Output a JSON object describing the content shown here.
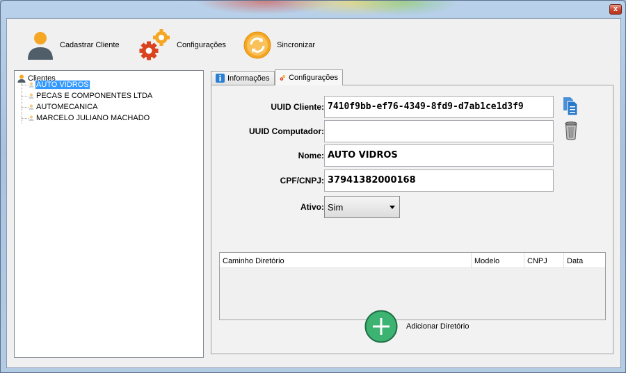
{
  "window": {
    "close_symbol": "x"
  },
  "toolbar": {
    "items": [
      {
        "label": "Cadastrar Cliente",
        "icon": "user-icon"
      },
      {
        "label": "Configurações",
        "icon": "gears-icon"
      },
      {
        "label": "Sincronizar",
        "icon": "sync-icon"
      }
    ]
  },
  "tree": {
    "root": "Clientes",
    "items": [
      {
        "label": "AUTO VIDROS",
        "selected": true
      },
      {
        "label": "PECAS E COMPONENTES LTDA",
        "selected": false
      },
      {
        "label": "AUTOMECANICA",
        "selected": false
      },
      {
        "label": "MARCELO JULIANO MACHADO",
        "selected": false
      }
    ]
  },
  "tabs": [
    {
      "label": "Informações",
      "active": false
    },
    {
      "label": "Configurações",
      "active": true
    }
  ],
  "form": {
    "uuid_cliente": {
      "label": "UUID Cliente:",
      "value": "7410f9bb-ef76-4349-8fd9-d7ab1ce1d3f9"
    },
    "uuid_computador": {
      "label": "UUID Computador:",
      "value": ""
    },
    "nome": {
      "label": "Nome:",
      "value": "AUTO VIDROS"
    },
    "cpf_cnpj": {
      "label": "CPF/CNPJ:",
      "value": "37941382000168"
    },
    "ativo": {
      "label": "Ativo:",
      "value": "Sim"
    }
  },
  "table": {
    "columns": [
      "Caminho Diretório",
      "Modelo",
      "CNPJ",
      "Data"
    ],
    "rows": []
  },
  "add_directory": {
    "label": "Adicionar Diretório"
  },
  "colors": {
    "selection": "#3399ff",
    "accent_orange": "#f5a623",
    "gear_red": "#d9431e",
    "add_green": "#3cb371"
  }
}
